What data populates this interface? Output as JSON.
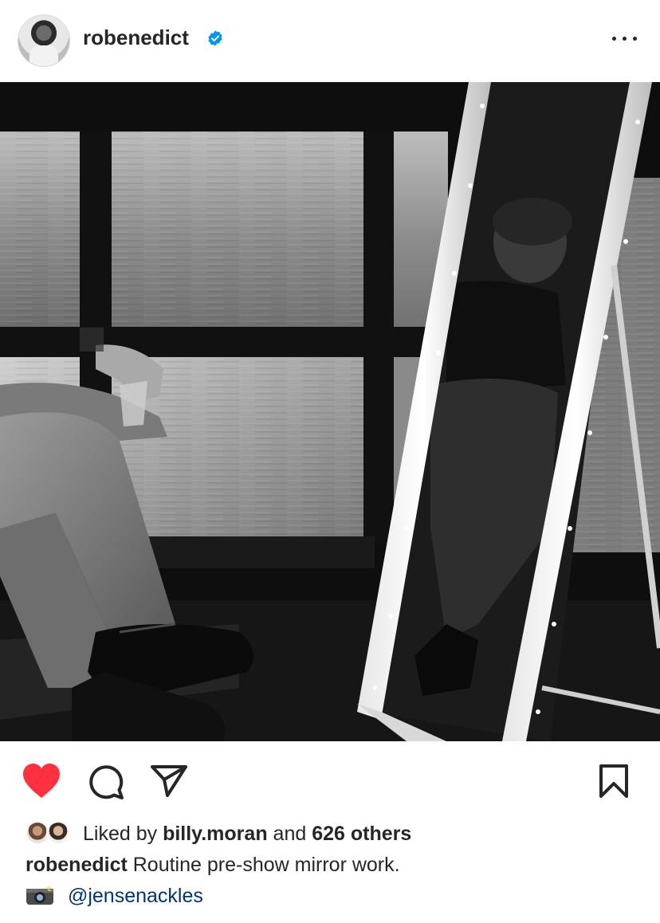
{
  "post": {
    "username": "robenedict",
    "verified": true,
    "accent_blue": "#0095f6",
    "like_color": "#ff3040",
    "liked": true
  },
  "icons": {
    "more": "more-horizontal-icon",
    "like": "heart-filled-icon",
    "comment": "comment-bubble-icon",
    "share": "paper-plane-icon",
    "save": "bookmark-icon",
    "credit": "camera-flash-emoji"
  },
  "likes": {
    "prefix": "Liked by",
    "user": "billy.moran",
    "joiner": "and",
    "others": "626 others"
  },
  "caption": {
    "username": "robenedict",
    "text": "Routine pre-show mirror work."
  },
  "credit": {
    "emoji": "📸",
    "mention": "@jensenackles"
  }
}
